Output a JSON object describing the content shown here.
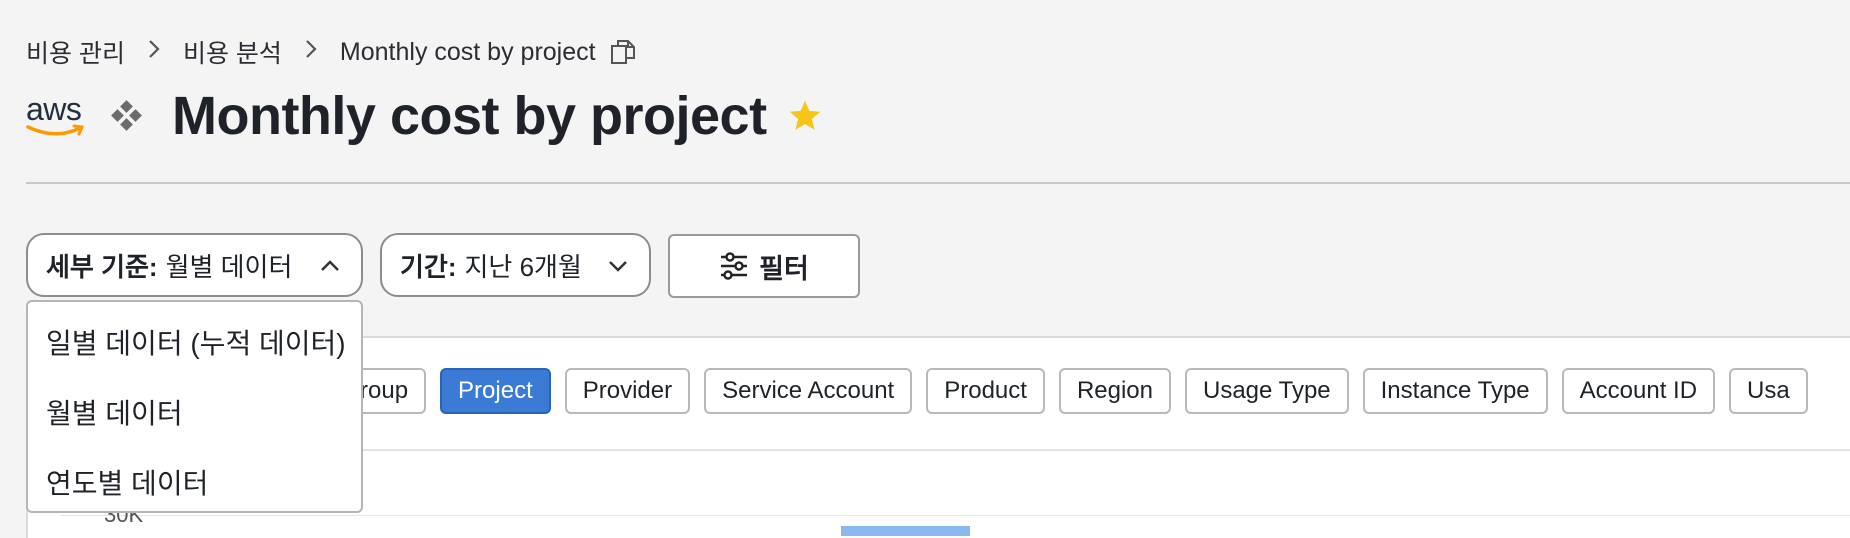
{
  "breadcrumb": {
    "items": [
      "비용 관리",
      "비용 분석",
      "Monthly cost by project"
    ]
  },
  "header": {
    "logo_text": "aws",
    "title": "Monthly cost by project",
    "accent_color": "#ff9900",
    "star_color": "#f5c518"
  },
  "controls": {
    "detail": {
      "label": "세부 기준:",
      "value": "월별 데이터"
    },
    "period": {
      "label": "기간:",
      "value": "지난 6개월"
    },
    "filter_label": "필터"
  },
  "dropdown": {
    "options": [
      "일별 데이터 (누적 데이터)",
      "월별 데이터",
      "연도별 데이터"
    ]
  },
  "group_by": {
    "chips": [
      {
        "label": "t Group",
        "active": false
      },
      {
        "label": "Project",
        "active": true
      },
      {
        "label": "Provider",
        "active": false
      },
      {
        "label": "Service Account",
        "active": false
      },
      {
        "label": "Product",
        "active": false
      },
      {
        "label": "Region",
        "active": false
      },
      {
        "label": "Usage Type",
        "active": false
      },
      {
        "label": "Instance Type",
        "active": false
      },
      {
        "label": "Account ID",
        "active": false
      },
      {
        "label": "Usa",
        "active": false
      }
    ],
    "active_color": "#3b7bd6"
  },
  "chart_data": {
    "type": "bar",
    "y_tick_labels": [
      "30K"
    ],
    "bar_color": "#8ab9ef"
  }
}
